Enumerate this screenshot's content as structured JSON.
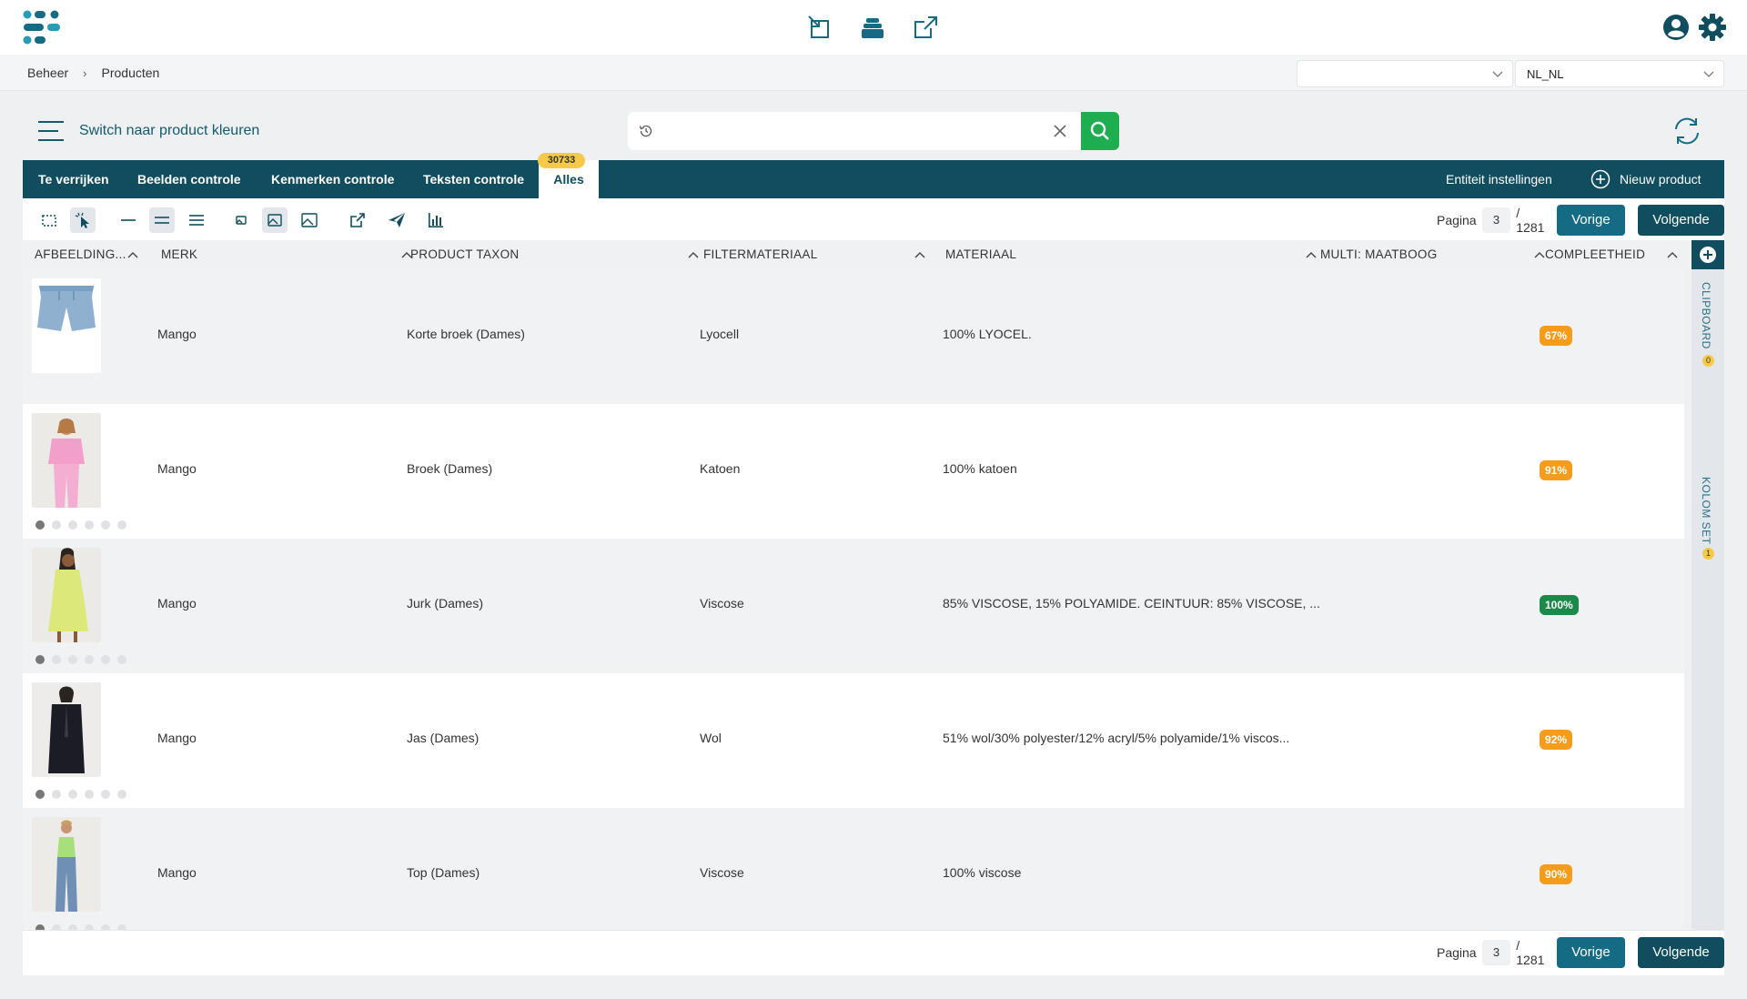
{
  "topbar": {
    "icons": [
      "collapse-icon",
      "stack-icon",
      "external-link-icon",
      "user-icon",
      "gear-icon"
    ]
  },
  "breadcrumb": {
    "items": [
      "Beheer",
      "Producten"
    ],
    "separator": "›"
  },
  "selects": {
    "first_value": "",
    "locale_value": "NL_NL"
  },
  "actions": {
    "switch_label": "Switch naar product kleuren"
  },
  "search": {
    "value": "",
    "placeholder": ""
  },
  "tabs": {
    "items": [
      "Te verrijken",
      "Beelden controle",
      "Kenmerken controle",
      "Teksten controle",
      "Alles"
    ],
    "active": "Alles",
    "badge": "30733",
    "entity_settings": "Entiteit instellingen",
    "new_product": "Nieuw product"
  },
  "pagination": {
    "label": "Pagina",
    "current": "3",
    "total": "/ 1281",
    "prev": "Vorige",
    "next": "Volgende"
  },
  "table": {
    "columns": [
      "AFBEELDING...",
      "MERK",
      "PRODUCT TAXON",
      "FILTERMATERIAAL",
      "MATERIAAL",
      "MULTI: MAATBOOG",
      "COMPLEETHEID"
    ],
    "rows": [
      {
        "brand": "Mango",
        "taxon": "Korte broek (Dames)",
        "filter": "Lyocell",
        "material": "100% LYOCEL.",
        "maatboog": "",
        "complete": "67%",
        "color": "#f59c1a"
      },
      {
        "brand": "Mango",
        "taxon": "Broek (Dames)",
        "filter": "Katoen",
        "material": "100% katoen",
        "maatboog": "",
        "complete": "91%",
        "color": "#f59c1a"
      },
      {
        "brand": "Mango",
        "taxon": "Jurk (Dames)",
        "filter": "Viscose",
        "material": "85% VISCOSE, 15% POLYAMIDE. CEINTUUR: 85% VISCOSE, ...",
        "maatboog": "",
        "complete": "100%",
        "color": "#1a8a4a"
      },
      {
        "brand": "Mango",
        "taxon": "Jas (Dames)",
        "filter": "Wol",
        "material": "51% wol/30% polyester/12% acryl/5% polyamide/1% viscos...",
        "maatboog": "",
        "complete": "92%",
        "color": "#f59c1a"
      },
      {
        "brand": "Mango",
        "taxon": "Top (Dames)",
        "filter": "Viscose",
        "material": "100% viscose",
        "maatboog": "",
        "complete": "90%",
        "color": "#f59c1a"
      }
    ]
  },
  "sidepanel": {
    "clipboard_label": "CLIPBOARD",
    "clipboard_count": "0",
    "kolomset_label": "KOLOM SET",
    "kolomset_count": "1"
  },
  "colors": {
    "primary": "#0f4d5f",
    "search_button": "#1fae4f",
    "badge": "#f7c948",
    "incomplete": "#f59c1a",
    "complete": "#1a8a4a"
  }
}
